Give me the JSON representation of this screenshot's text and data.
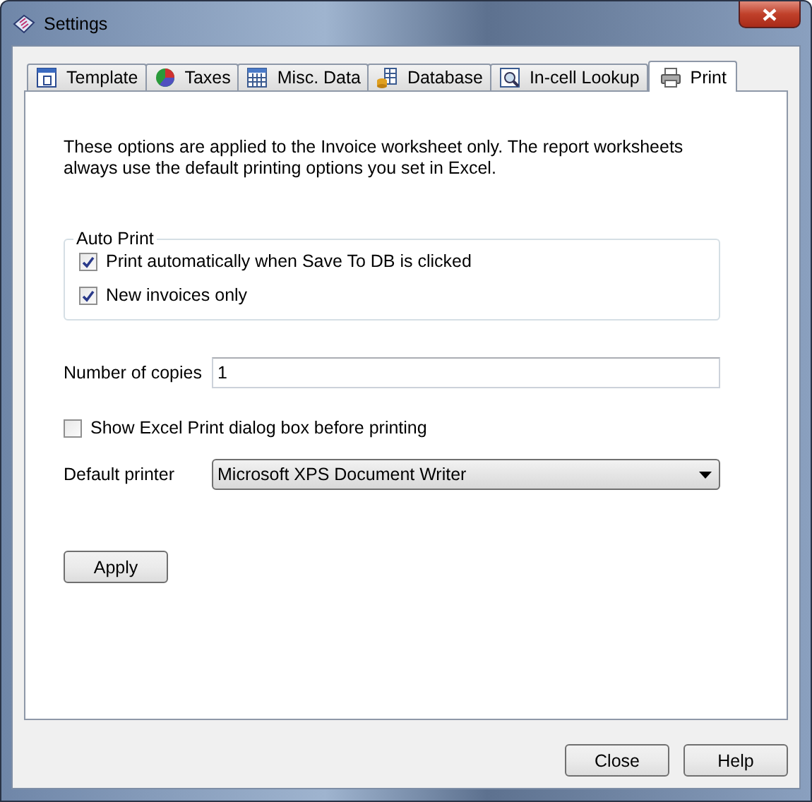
{
  "window": {
    "title": "Settings"
  },
  "tabs": [
    {
      "label": "Template",
      "selected": false
    },
    {
      "label": "Taxes",
      "selected": false
    },
    {
      "label": "Misc. Data",
      "selected": false
    },
    {
      "label": "Database",
      "selected": false
    },
    {
      "label": "In-cell Lookup",
      "selected": false
    },
    {
      "label": "Print",
      "selected": true
    }
  ],
  "intro": "These options are applied to the Invoice worksheet only. The report worksheets always use the default printing options you set in Excel.",
  "auto_print": {
    "title": "Auto Print",
    "options": [
      {
        "label": "Print automatically when Save To DB is clicked",
        "checked": true
      },
      {
        "label": "New invoices only",
        "checked": true
      }
    ]
  },
  "copies": {
    "label": "Number of copies",
    "value": "1"
  },
  "show_dialog": {
    "label": "Show Excel Print dialog box before printing",
    "checked": false
  },
  "printer": {
    "label": "Default printer",
    "value": "Microsoft XPS Document Writer"
  },
  "apply_button": "Apply",
  "buttons": [
    "Close",
    "Help"
  ]
}
